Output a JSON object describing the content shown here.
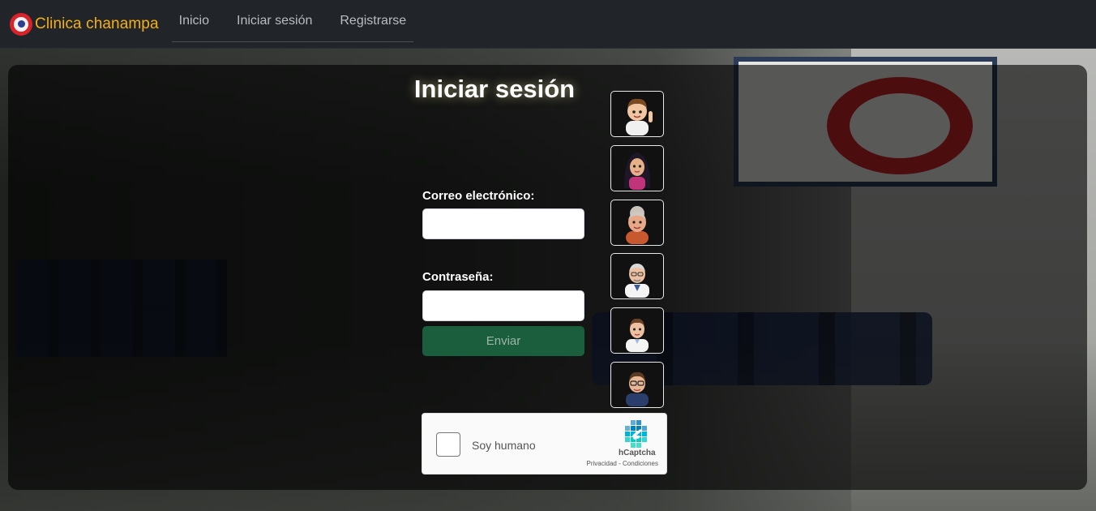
{
  "navbar": {
    "brand": "Clinica chanampa",
    "links": [
      "Inicio",
      "Iniciar sesión",
      "Registrarse"
    ]
  },
  "form": {
    "title": "Iniciar sesión",
    "email_label": "Correo electrónico:",
    "email_value": "",
    "password_label": "Contraseña:",
    "password_value": "",
    "submit_label": "Enviar"
  },
  "avatars": [
    "boy-waving-avatar",
    "woman-dark-hair-avatar",
    "elderly-woman-avatar",
    "elderly-doctor-avatar",
    "doctor-avatar",
    "man-glasses-avatar"
  ],
  "captcha": {
    "label": "Soy humano",
    "brand": "hCaptcha",
    "links": "Privacidad - Condiciones"
  },
  "colors": {
    "navbar_bg": "#212529",
    "brand": "#f5b014",
    "submit_bg": "#1a5e3d",
    "captcha_accent": "#0074bf"
  }
}
